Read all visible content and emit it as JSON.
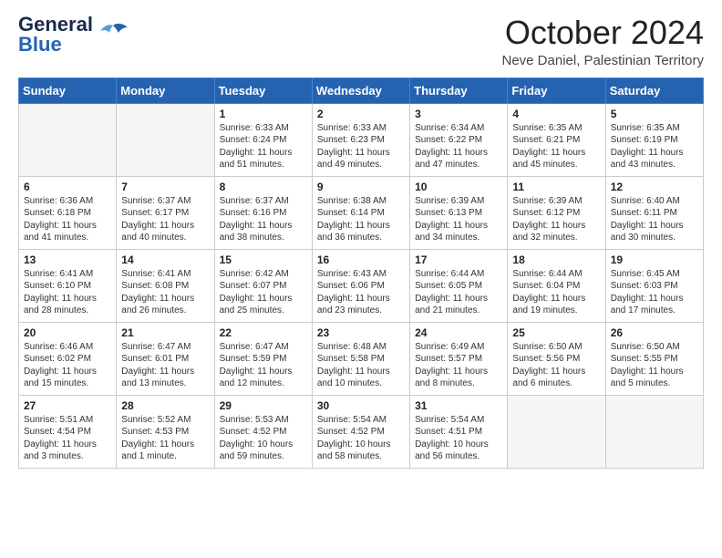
{
  "header": {
    "logo_line1": "General",
    "logo_line2": "Blue",
    "month": "October 2024",
    "location": "Neve Daniel, Palestinian Territory"
  },
  "days_of_week": [
    "Sunday",
    "Monday",
    "Tuesday",
    "Wednesday",
    "Thursday",
    "Friday",
    "Saturday"
  ],
  "weeks": [
    [
      {
        "day": "",
        "content": ""
      },
      {
        "day": "",
        "content": ""
      },
      {
        "day": "1",
        "content": "Sunrise: 6:33 AM\nSunset: 6:24 PM\nDaylight: 11 hours and 51 minutes."
      },
      {
        "day": "2",
        "content": "Sunrise: 6:33 AM\nSunset: 6:23 PM\nDaylight: 11 hours and 49 minutes."
      },
      {
        "day": "3",
        "content": "Sunrise: 6:34 AM\nSunset: 6:22 PM\nDaylight: 11 hours and 47 minutes."
      },
      {
        "day": "4",
        "content": "Sunrise: 6:35 AM\nSunset: 6:21 PM\nDaylight: 11 hours and 45 minutes."
      },
      {
        "day": "5",
        "content": "Sunrise: 6:35 AM\nSunset: 6:19 PM\nDaylight: 11 hours and 43 minutes."
      }
    ],
    [
      {
        "day": "6",
        "content": "Sunrise: 6:36 AM\nSunset: 6:18 PM\nDaylight: 11 hours and 41 minutes."
      },
      {
        "day": "7",
        "content": "Sunrise: 6:37 AM\nSunset: 6:17 PM\nDaylight: 11 hours and 40 minutes."
      },
      {
        "day": "8",
        "content": "Sunrise: 6:37 AM\nSunset: 6:16 PM\nDaylight: 11 hours and 38 minutes."
      },
      {
        "day": "9",
        "content": "Sunrise: 6:38 AM\nSunset: 6:14 PM\nDaylight: 11 hours and 36 minutes."
      },
      {
        "day": "10",
        "content": "Sunrise: 6:39 AM\nSunset: 6:13 PM\nDaylight: 11 hours and 34 minutes."
      },
      {
        "day": "11",
        "content": "Sunrise: 6:39 AM\nSunset: 6:12 PM\nDaylight: 11 hours and 32 minutes."
      },
      {
        "day": "12",
        "content": "Sunrise: 6:40 AM\nSunset: 6:11 PM\nDaylight: 11 hours and 30 minutes."
      }
    ],
    [
      {
        "day": "13",
        "content": "Sunrise: 6:41 AM\nSunset: 6:10 PM\nDaylight: 11 hours and 28 minutes."
      },
      {
        "day": "14",
        "content": "Sunrise: 6:41 AM\nSunset: 6:08 PM\nDaylight: 11 hours and 26 minutes."
      },
      {
        "day": "15",
        "content": "Sunrise: 6:42 AM\nSunset: 6:07 PM\nDaylight: 11 hours and 25 minutes."
      },
      {
        "day": "16",
        "content": "Sunrise: 6:43 AM\nSunset: 6:06 PM\nDaylight: 11 hours and 23 minutes."
      },
      {
        "day": "17",
        "content": "Sunrise: 6:44 AM\nSunset: 6:05 PM\nDaylight: 11 hours and 21 minutes."
      },
      {
        "day": "18",
        "content": "Sunrise: 6:44 AM\nSunset: 6:04 PM\nDaylight: 11 hours and 19 minutes."
      },
      {
        "day": "19",
        "content": "Sunrise: 6:45 AM\nSunset: 6:03 PM\nDaylight: 11 hours and 17 minutes."
      }
    ],
    [
      {
        "day": "20",
        "content": "Sunrise: 6:46 AM\nSunset: 6:02 PM\nDaylight: 11 hours and 15 minutes."
      },
      {
        "day": "21",
        "content": "Sunrise: 6:47 AM\nSunset: 6:01 PM\nDaylight: 11 hours and 13 minutes."
      },
      {
        "day": "22",
        "content": "Sunrise: 6:47 AM\nSunset: 5:59 PM\nDaylight: 11 hours and 12 minutes."
      },
      {
        "day": "23",
        "content": "Sunrise: 6:48 AM\nSunset: 5:58 PM\nDaylight: 11 hours and 10 minutes."
      },
      {
        "day": "24",
        "content": "Sunrise: 6:49 AM\nSunset: 5:57 PM\nDaylight: 11 hours and 8 minutes."
      },
      {
        "day": "25",
        "content": "Sunrise: 6:50 AM\nSunset: 5:56 PM\nDaylight: 11 hours and 6 minutes."
      },
      {
        "day": "26",
        "content": "Sunrise: 6:50 AM\nSunset: 5:55 PM\nDaylight: 11 hours and 5 minutes."
      }
    ],
    [
      {
        "day": "27",
        "content": "Sunrise: 5:51 AM\nSunset: 4:54 PM\nDaylight: 11 hours and 3 minutes."
      },
      {
        "day": "28",
        "content": "Sunrise: 5:52 AM\nSunset: 4:53 PM\nDaylight: 11 hours and 1 minute."
      },
      {
        "day": "29",
        "content": "Sunrise: 5:53 AM\nSunset: 4:52 PM\nDaylight: 10 hours and 59 minutes."
      },
      {
        "day": "30",
        "content": "Sunrise: 5:54 AM\nSunset: 4:52 PM\nDaylight: 10 hours and 58 minutes."
      },
      {
        "day": "31",
        "content": "Sunrise: 5:54 AM\nSunset: 4:51 PM\nDaylight: 10 hours and 56 minutes."
      },
      {
        "day": "",
        "content": ""
      },
      {
        "day": "",
        "content": ""
      }
    ]
  ]
}
